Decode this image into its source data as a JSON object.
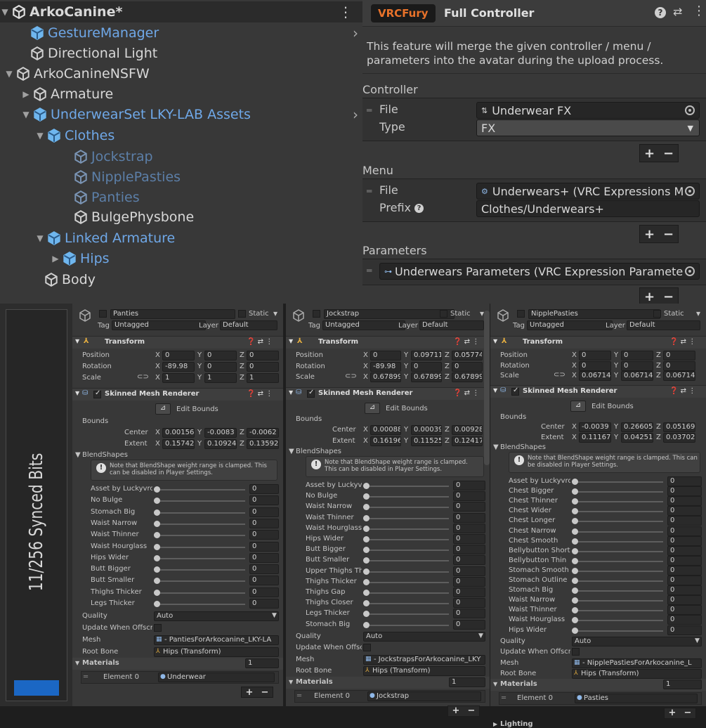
{
  "hierarchy": {
    "scene_title": "ArkoCanine*",
    "items": [
      {
        "label": "GestureManager",
        "color": "blue",
        "arrow": ""
      },
      {
        "label": "Directional Light",
        "color": "white",
        "arrow": ""
      },
      {
        "label": "ArkoCanineNSFW",
        "color": "white",
        "arrow": "▼"
      },
      {
        "label": "Armature",
        "color": "white",
        "arrow": "▶"
      },
      {
        "label": "UnderwearSet LKY-LAB Assets",
        "color": "blue",
        "arrow": "▼"
      },
      {
        "label": "Clothes",
        "color": "blue",
        "arrow": "▼"
      },
      {
        "label": "Jockstrap",
        "color": "dim",
        "arrow": ""
      },
      {
        "label": "NipplePasties",
        "color": "dim",
        "arrow": ""
      },
      {
        "label": "Panties",
        "color": "dim",
        "arrow": ""
      },
      {
        "label": "BulgePhysbone",
        "color": "white",
        "arrow": ""
      },
      {
        "label": "Linked Armature",
        "color": "blue",
        "arrow": "▼"
      },
      {
        "label": "Hips",
        "color": "blue",
        "arrow": "▶"
      },
      {
        "label": "Body",
        "color": "white",
        "arrow": ""
      }
    ]
  },
  "vrcfury": {
    "badge": "VRCFury",
    "title": "Full Controller",
    "description": "This feature will merge the given controller / menu / parameters into the avatar during the upload process.",
    "controller": {
      "section": "Controller",
      "file_label": "File",
      "file_value": "Underwear FX",
      "type_label": "Type",
      "type_value": "FX"
    },
    "menu": {
      "section": "Menu",
      "file_label": "File",
      "file_value": "Underwears+ (VRC Expressions M",
      "prefix_label": "Prefix",
      "prefix_value": "Clothes/Underwears+"
    },
    "parameters": {
      "section": "Parameters",
      "file_value": "Underwears Parameters (VRC Expression Paramete"
    },
    "plus": "+",
    "minus": "−"
  },
  "synced_bits": "11/256 Synced Bits",
  "inspectors": [
    {
      "name": "Panties",
      "static": "Static",
      "tag_label": "Tag",
      "tag": "Untagged",
      "layer_label": "Layer",
      "layer": "Default",
      "transform": "Transform",
      "position": [
        "0",
        "0",
        "0"
      ],
      "rotation": [
        "-89.98",
        "0",
        "0"
      ],
      "scale": [
        "1",
        "1",
        "1"
      ],
      "smr": "Skinned Mesh Renderer",
      "edit_bounds": "Edit Bounds",
      "bounds": "Bounds",
      "center": [
        "0.00156",
        "-0.0083",
        "-0.0062"
      ],
      "extent": [
        "0.15742",
        "0.10924",
        "0.13592"
      ],
      "blendshapes_label": "BlendShapes",
      "notice": "Note that BlendShape weight range is clamped. This can be disabled in Player Settings.",
      "blendshapes": [
        "Asset by Luckyvrc",
        "No Bulge",
        "Stomach Big",
        "Waist Narrow",
        "Waist Thinner",
        "Waist Hourglass",
        "Hips Wider",
        "Butt Bigger",
        "Butt Smaller",
        "Thighs Thicker",
        "Legs Thicker"
      ],
      "quality": "Auto",
      "mesh": "- PantiesForArkocanine_LKY-LA",
      "root_bone": "Hips (Transform)",
      "materials_count": "1",
      "element": "Underwear"
    },
    {
      "name": "Jockstrap",
      "static": "Static",
      "tag_label": "Tag",
      "tag": "Untagged",
      "layer_label": "Layer",
      "layer": "Default",
      "transform": "Transform",
      "position": [
        "0",
        "0.097114",
        "0.05774"
      ],
      "rotation": [
        "-89.98",
        "0",
        "0"
      ],
      "scale": [
        "0.678996",
        "0.678996",
        "0.678996"
      ],
      "smr": "Skinned Mesh Renderer",
      "edit_bounds": "Edit Bounds",
      "bounds": "Bounds",
      "center": [
        "0.00088",
        "0.00039",
        "0.00928"
      ],
      "extent": [
        "0.161969",
        "0.115255",
        "0.124177"
      ],
      "blendshapes_label": "BlendShapes",
      "notice": "Note that BlendShape weight range is clamped. This can be disabled in Player Settings.",
      "blendshapes": [
        "Asset by Luckyvrc",
        "No Bulge",
        "Waist Narrow",
        "Waist Thinner",
        "Waist Hourglass",
        "Hips Wider",
        "Butt Bigger",
        "Butt Smaller",
        "Upper Thighs Thick",
        "Thighs Thicker",
        "Thighs Gap",
        "Thighs Closer",
        "Legs Thicker",
        "Stomach Big"
      ],
      "quality": "Auto",
      "mesh": "- JockstrapsForArkocanine_LKY",
      "root_bone": "Hips (Transform)",
      "materials_count": "1",
      "element": "Jockstrap"
    },
    {
      "name": "NipplePasties",
      "static": "Static",
      "tag_label": "Tag",
      "tag": "Untagged",
      "layer_label": "Layer",
      "layer": "Default",
      "transform": "Transform",
      "position": [
        "0",
        "0",
        "0"
      ],
      "rotation": [
        "0",
        "0",
        "0"
      ],
      "scale": [
        "0.06714",
        "0.06714",
        "0.06714"
      ],
      "smr": "Skinned Mesh Renderer",
      "edit_bounds": "Edit Bounds",
      "bounds": "Bounds",
      "center": [
        "-0.0039",
        "0.26605",
        "0.05169"
      ],
      "extent": [
        "0.111673",
        "0.04251",
        "0.03702"
      ],
      "blendshapes_label": "BlendShapes",
      "notice": "Note that BlendShape weight range is clamped. This can be disabled in Player Settings.",
      "blendshapes": [
        "Asset by Luckyvrc",
        "Chest Bigger",
        "Chest Thinner",
        "Chest Wider",
        "Chest Longer",
        "Chest Narrow",
        "Chest Smooth",
        "Bellybutton Short",
        "Bellybutton Thin",
        "Stomach Smooth",
        "Stomach Outline",
        "Stomach Big",
        "Waist Narrow",
        "Waist Thinner",
        "Waist Hourglass",
        "Hips Wider"
      ],
      "quality": "Auto",
      "mesh": "- NipplePastiesForArkocanine_L",
      "root_bone": "Hips (Transform)",
      "materials_count": "1",
      "element": "Pasties",
      "lighting": "Lighting"
    }
  ],
  "common": {
    "position": "Position",
    "rotation": "Rotation",
    "scale": "Scale",
    "x": "X",
    "y": "Y",
    "z": "Z",
    "center": "Center",
    "extent": "Extent",
    "quality_label": "Quality",
    "update_offscreen": "Update When Offscre",
    "mesh_label": "Mesh",
    "root_bone_label": "Root Bone",
    "materials_label": "Materials",
    "element_label": "Element 0",
    "slider_value": "0"
  }
}
